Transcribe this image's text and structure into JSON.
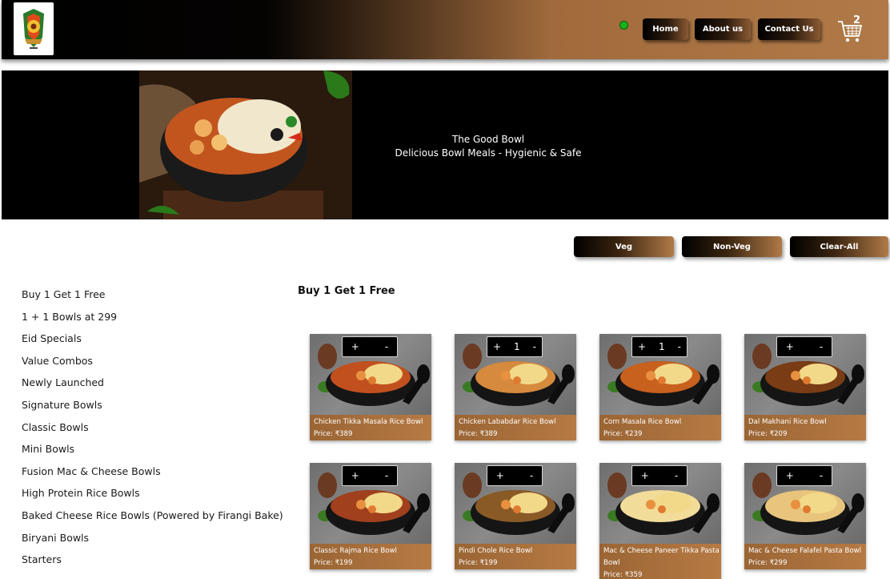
{
  "header": {
    "logo_icon": "the-good-bowl-logo",
    "status_color": "#16b41a",
    "nav": [
      "Home",
      "About us",
      "Contact Us"
    ],
    "cart_icon": "shopping-cart-icon",
    "cart_count": "2"
  },
  "banner": {
    "title": "The Good Bowl",
    "subtitle": "Delicious Bowl Meals - Hygienic & Safe"
  },
  "filters": [
    "Veg",
    "Non-Veg",
    "Clear-All"
  ],
  "sidebar": {
    "categories": [
      "Buy 1 Get 1 Free",
      "1 + 1 Bowls at 299",
      "Eid Specials",
      "Value Combos",
      "Newly Launched",
      "Signature Bowls",
      "Classic Bowls",
      "Mini Bowls",
      "Fusion Mac & Cheese Bowls",
      "High Protein Rice Bowls",
      "Baked Cheese Rice Bowls (Powered by Firangi Bake)",
      "Biryani Bowls",
      "Starters"
    ]
  },
  "section": {
    "title": "Buy 1 Get 1 Free"
  },
  "products": [
    {
      "name": "Chicken Tikka Masala Rice Bowl",
      "price": "Price: ₹389",
      "qty": "",
      "curry": "#c2501e"
    },
    {
      "name": "Chicken Lababdar Rice Bowl",
      "price": "Price: ₹389",
      "qty": "1",
      "curry": "#d58a3e"
    },
    {
      "name": "Corn Masala Rice Bowl",
      "price": "Price: ₹239",
      "qty": "1",
      "curry": "#c8601e"
    },
    {
      "name": "Dal Makhani Rice Bowl",
      "price": "Price: ₹209",
      "qty": "",
      "curry": "#7a3c14"
    },
    {
      "name": "Classic Rajma Rice Bowl",
      "price": "Price: ₹199",
      "qty": "",
      "curry": "#a0401c"
    },
    {
      "name": "Pindi Chole Rice Bowl",
      "price": "Price: ₹199",
      "qty": "",
      "curry": "#8a5a26"
    },
    {
      "name": "Mac & Cheese Paneer Tikka Pasta Bowl",
      "price": "Price: ₹359",
      "qty": "",
      "curry": "#f2dc9a"
    },
    {
      "name": "Mac & Cheese Falafel Pasta Bowl",
      "price": "Price: ₹299",
      "qty": "",
      "curry": "#e8c47c"
    }
  ],
  "qty_controls": {
    "plus": "+",
    "minus": "-"
  }
}
